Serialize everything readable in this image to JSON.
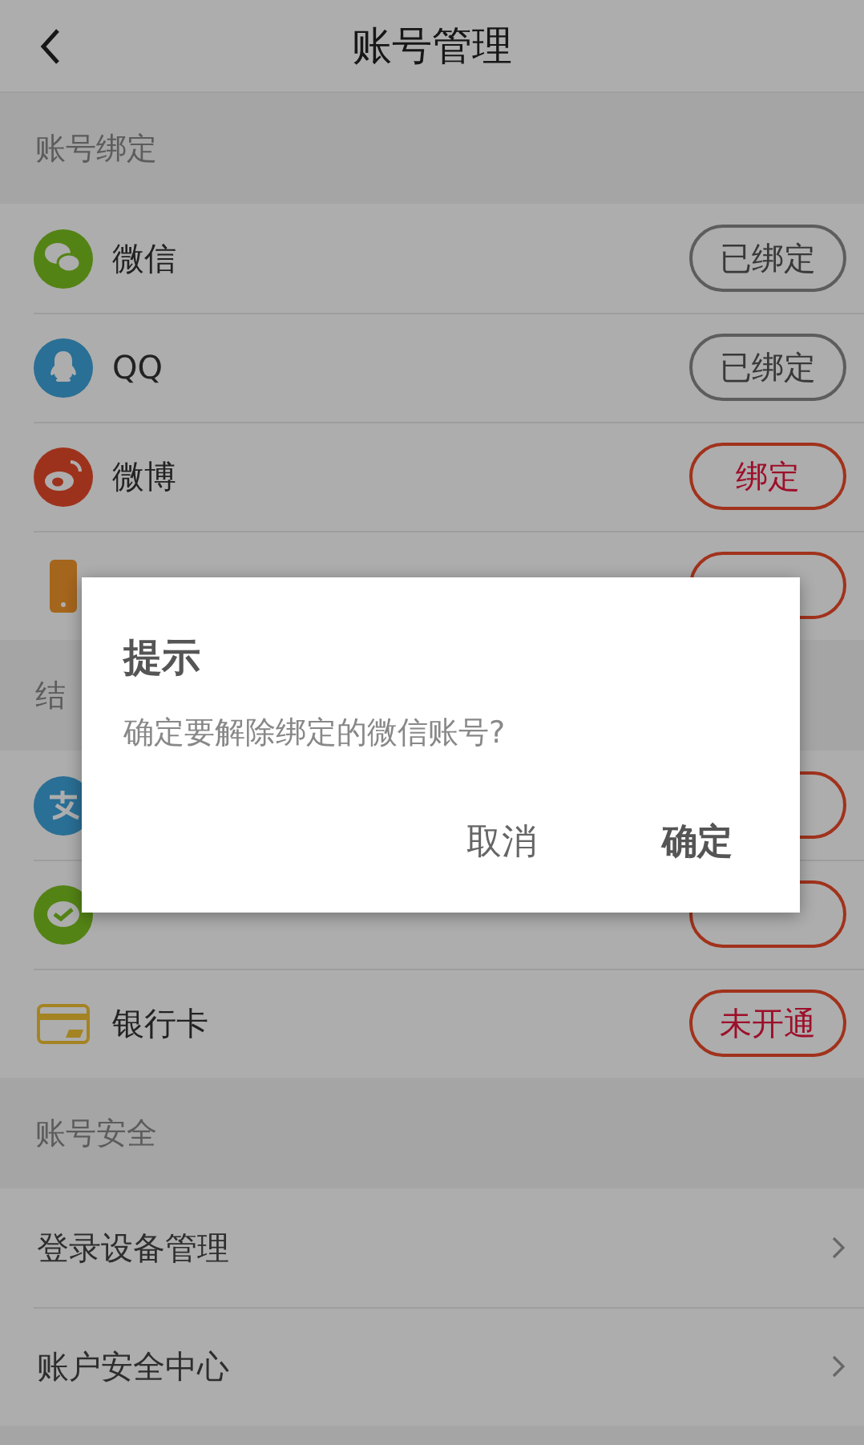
{
  "header": {
    "title": "账号管理"
  },
  "sections": [
    {
      "title": "账号绑定",
      "rows": [
        {
          "kind": "wechat",
          "label": "微信",
          "button": {
            "text": "已绑定",
            "bound": true
          }
        },
        {
          "kind": "qq",
          "label": "QQ",
          "button": {
            "text": "已绑定",
            "bound": true
          }
        },
        {
          "kind": "weibo",
          "label": "微博",
          "button": {
            "text": "绑定",
            "bound": false
          }
        },
        {
          "kind": "phone",
          "button": {
            "bound": false
          }
        }
      ]
    },
    {
      "title": "结",
      "rows": [
        {
          "kind": "alipay",
          "button": {
            "bound": false
          }
        },
        {
          "kind": "wechatpay",
          "button": {
            "bound": false
          }
        },
        {
          "kind": "card",
          "label": "银行卡",
          "button": {
            "text": "未开通",
            "bound": false
          }
        }
      ]
    },
    {
      "title": "账号安全",
      "rows": [
        {
          "kind": "link",
          "label": "登录设备管理"
        },
        {
          "kind": "link",
          "label": "账户安全中心"
        }
      ]
    }
  ],
  "dialog": {
    "title": "提示",
    "message": "确定要解除绑定的微信账号?",
    "buttons": [
      {
        "label": "取消",
        "primary": false
      },
      {
        "label": "确定",
        "primary": true
      }
    ]
  }
}
